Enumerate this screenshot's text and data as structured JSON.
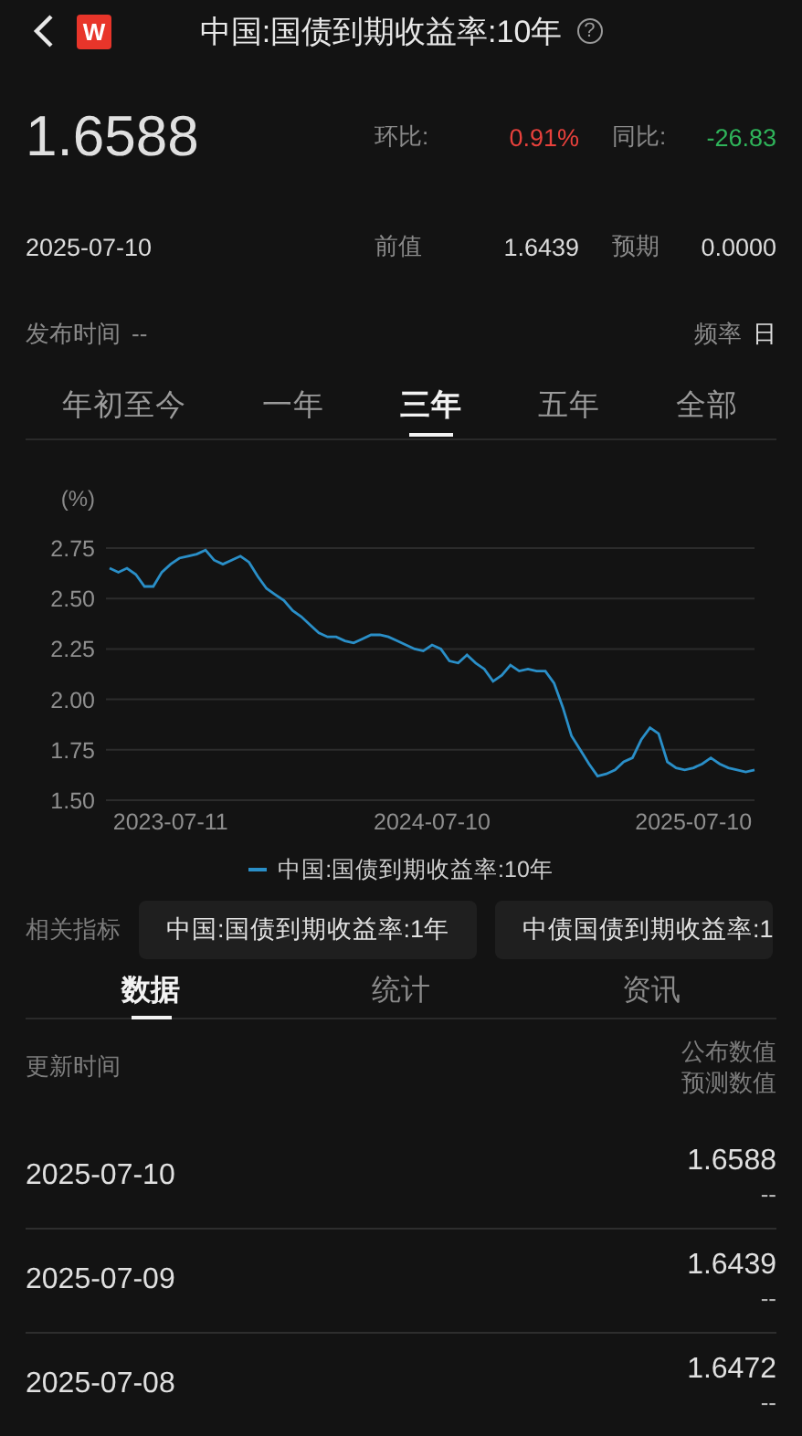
{
  "header": {
    "logo": "W",
    "title": "中国:国债到期收益率:10年",
    "help": "?"
  },
  "summary": {
    "value": "1.6588",
    "date": "2025-07-10",
    "stats": [
      {
        "label": "环比:",
        "value": "0.91%",
        "kind": "rise"
      },
      {
        "label": "同比:",
        "value": "-26.83",
        "kind": "fall"
      },
      {
        "label": "前值",
        "value": "1.6439",
        "kind": "plain"
      },
      {
        "label": "预期",
        "value": "0.0000",
        "kind": "plain"
      }
    ]
  },
  "release": {
    "label": "发布时间",
    "value": "--"
  },
  "frequency": {
    "label": "频率",
    "value": "日"
  },
  "periods": [
    {
      "label": "年初至今",
      "selected": false
    },
    {
      "label": "一年",
      "selected": false
    },
    {
      "label": "三年",
      "selected": true
    },
    {
      "label": "五年",
      "selected": false
    },
    {
      "label": "全部",
      "selected": false
    }
  ],
  "chart": {
    "chart_data": {
      "type": "line",
      "ylabel": "(%)",
      "categories": [
        null,
        null,
        null,
        null,
        null,
        null,
        null,
        "2023-07-11",
        null,
        null,
        null,
        null,
        null,
        null,
        null,
        null,
        null,
        null,
        null,
        null,
        null,
        null,
        null,
        null,
        null,
        null,
        null,
        null,
        null,
        null,
        null,
        null,
        null,
        null,
        null,
        null,
        null,
        "2024-07-10",
        null,
        null,
        null,
        null,
        null,
        null,
        null,
        null,
        null,
        null,
        null,
        null,
        null,
        null,
        null,
        null,
        null,
        null,
        null,
        null,
        null,
        null,
        null,
        null,
        null,
        null,
        null,
        null,
        null,
        "2025-07-10",
        null,
        null,
        null,
        null,
        null,
        null,
        null
      ],
      "series": [
        {
          "name": "中国:国债到期收益率:10年",
          "color": "#2a8fc8",
          "values": [
            2.65,
            2.63,
            2.65,
            2.62,
            2.56,
            2.56,
            2.63,
            2.67,
            2.7,
            2.71,
            2.72,
            2.74,
            2.69,
            2.67,
            2.69,
            2.71,
            2.68,
            2.61,
            2.55,
            2.52,
            2.49,
            2.44,
            2.41,
            2.37,
            2.33,
            2.31,
            2.31,
            2.29,
            2.28,
            2.3,
            2.32,
            2.32,
            2.31,
            2.29,
            2.27,
            2.25,
            2.24,
            2.27,
            2.25,
            2.19,
            2.18,
            2.22,
            2.18,
            2.15,
            2.09,
            2.12,
            2.17,
            2.14,
            2.15,
            2.14,
            2.14,
            2.08,
            1.96,
            1.82,
            1.75,
            1.68,
            1.62,
            1.63,
            1.65,
            1.69,
            1.71,
            1.8,
            1.86,
            1.83,
            1.69,
            1.66,
            1.65,
            1.66,
            1.68,
            1.71,
            1.68,
            1.66,
            1.65,
            1.64,
            1.65
          ]
        }
      ],
      "grid": true,
      "ylim": [
        1.5,
        2.75
      ],
      "yticks": [
        {
          "value": 1.5,
          "label": "1.50"
        },
        {
          "value": 1.75,
          "label": "1.75"
        },
        {
          "value": 2.0,
          "label": "2.00"
        },
        {
          "value": 2.25,
          "label": "2.25"
        },
        {
          "value": 2.5,
          "label": "2.50"
        },
        {
          "value": 2.75,
          "label": "2.75"
        }
      ]
    }
  },
  "related": {
    "label": "相关指标",
    "items": [
      "中国:国债到期收益率:1年",
      "中债国债到期收益率:1"
    ]
  },
  "detail_tabs": [
    {
      "label": "数据",
      "selected": true
    },
    {
      "label": "统计",
      "selected": false
    },
    {
      "label": "资讯",
      "selected": false
    }
  ],
  "table": {
    "columns": {
      "date": "更新时间",
      "published": "公布数值",
      "forecast": "预测数值"
    },
    "rows": [
      {
        "date": "2025-07-10",
        "published": "1.6588",
        "forecast": "--"
      },
      {
        "date": "2025-07-09",
        "published": "1.6439",
        "forecast": "--"
      },
      {
        "date": "2025-07-08",
        "published": "1.6472",
        "forecast": "--"
      }
    ]
  }
}
